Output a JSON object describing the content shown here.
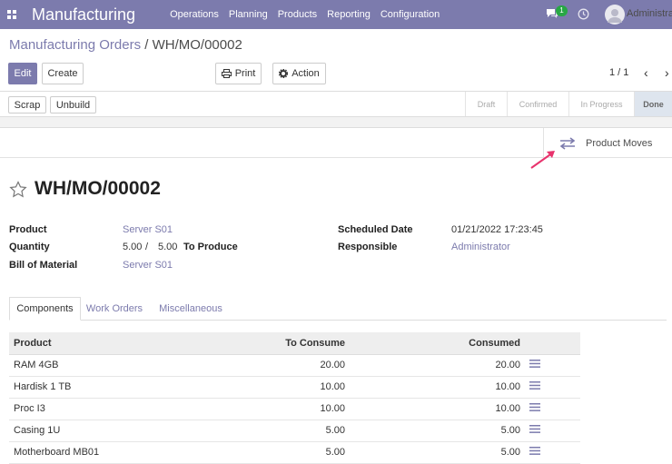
{
  "navbar": {
    "app_name": "Manufacturing",
    "menu": [
      "Operations",
      "Planning",
      "Products",
      "Reporting",
      "Configuration"
    ],
    "notification_count": "1",
    "user_name": "Administrator"
  },
  "breadcrumb": {
    "parent": "Manufacturing Orders",
    "separator": "/",
    "current": "WH/MO/00002"
  },
  "buttons": {
    "edit": "Edit",
    "create": "Create",
    "print": "Print",
    "action": "Action",
    "scrap": "Scrap",
    "unbuild": "Unbuild"
  },
  "pager": {
    "value": "1 / 1"
  },
  "stages": [
    "Draft",
    "Confirmed",
    "In Progress",
    "Done"
  ],
  "active_stage": "Done",
  "smart_button": {
    "label": "Product Moves"
  },
  "record": {
    "title": "WH/MO/00002",
    "product_label": "Product",
    "product": "Server S01",
    "quantity_label": "Quantity",
    "quantity": "5.00",
    "quantity_sep": "/",
    "quantity_total": "5.00",
    "to_produce": "To Produce",
    "bom_label": "Bill of Material",
    "bom": "Server S01",
    "scheduled_label": "Scheduled Date",
    "scheduled": "01/21/2022 17:23:45",
    "responsible_label": "Responsible",
    "responsible": "Administrator"
  },
  "tabs": [
    "Components",
    "Work Orders",
    "Miscellaneous"
  ],
  "table": {
    "headers": [
      "Product",
      "To Consume",
      "Consumed"
    ],
    "rows": [
      {
        "product": "RAM 4GB",
        "to_consume": "20.00",
        "consumed": "20.00"
      },
      {
        "product": "Hardisk 1 TB",
        "to_consume": "10.00",
        "consumed": "10.00"
      },
      {
        "product": "Proc I3",
        "to_consume": "10.00",
        "consumed": "10.00"
      },
      {
        "product": "Casing 1U",
        "to_consume": "5.00",
        "consumed": "5.00"
      },
      {
        "product": "Motherboard MB01",
        "to_consume": "5.00",
        "consumed": "5.00"
      }
    ]
  },
  "colors": {
    "brand": "#7c7bad",
    "annotation_arrow": "#e8336d"
  }
}
